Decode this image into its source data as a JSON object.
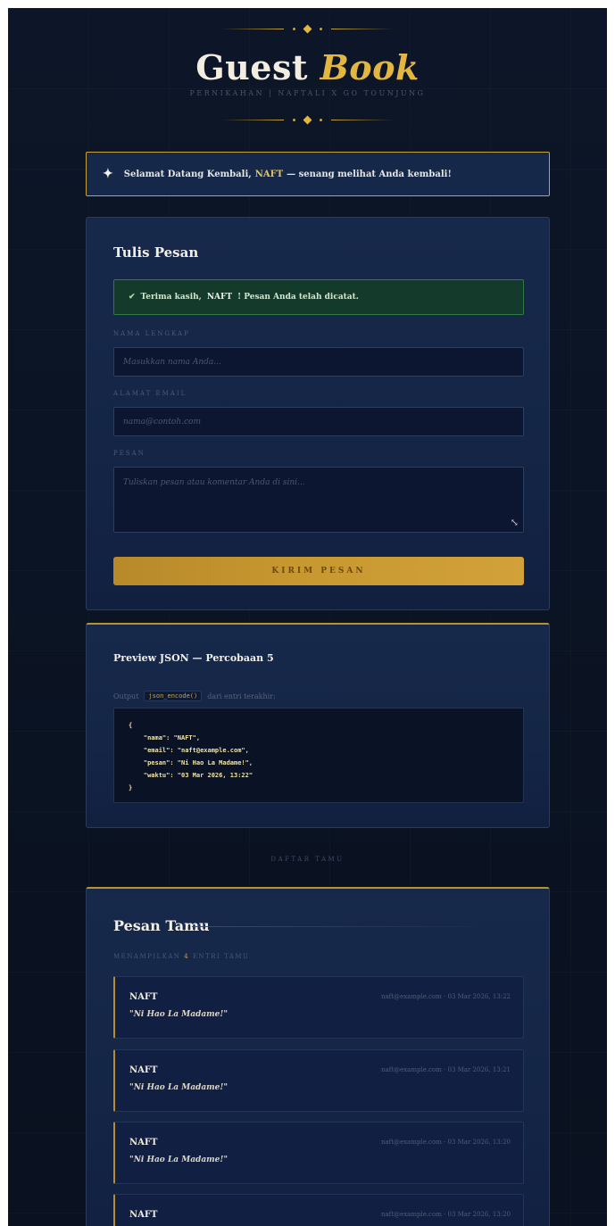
{
  "header": {
    "title_main": "Guest",
    "title_accent": "Book",
    "subtitle": "PERNIKAHAN | NAFTALI X GO TOUNJUNG"
  },
  "welcome": {
    "prefix": "Selamat Datang Kembali,",
    "name": "NAFT",
    "suffix": "— senang melihat Anda kembali!"
  },
  "form": {
    "title": "Tulis Pesan",
    "alert_prefix": "Terima kasih,",
    "alert_name": "NAFT",
    "alert_suffix": "! Pesan Anda telah dicatat.",
    "name_label": "NAMA LENGKAP",
    "name_placeholder": "Masukkan nama Anda...",
    "email_label": "ALAMAT EMAIL",
    "email_placeholder": "nama@contoh.com",
    "message_label": "PESAN",
    "message_placeholder": "Tuliskan pesan atau komentar Anda di sini...",
    "submit_label": "KIRIM PESAN"
  },
  "preview": {
    "title": "Preview JSON — Percobaan 5",
    "output_prefix": "Output",
    "output_code": "json_encode()",
    "output_suffix": "dari entri terakhir:",
    "code": "{\n    \"nama\": \"NAFT\",\n    \"email\": \"naft@example.com\",\n    \"pesan\": \"Ni Hao La Madame!\",\n    \"waktu\": \"03 Mar 2026, 13:22\"\n}"
  },
  "divider": "DAFTAR TAMU",
  "guestbook": {
    "title": "Pesan Tamu",
    "subtitle_prefix": "MENAMPILKAN",
    "subtitle_count": "4",
    "subtitle_suffix": "ENTRI TAMU",
    "entries": [
      {
        "name": "NAFT",
        "meta": "naft@example.com · 03 Mar 2026, 13:22",
        "message": "\"Ni Hao La Madame!\""
      },
      {
        "name": "NAFT",
        "meta": "naft@example.com · 03 Mar 2026, 13:21",
        "message": "\"Ni Hao La Madame!\""
      },
      {
        "name": "NAFT",
        "meta": "naft@example.com · 03 Mar 2026, 13:20",
        "message": "\"Ni Hao La Madame!\""
      },
      {
        "name": "NAFT",
        "meta": "naft@example.com · 03 Mar 2026, 13:20",
        "message": ""
      }
    ]
  },
  "colors": {
    "background": "#0b1424",
    "card": "#16284a",
    "gold": "#c9a23a",
    "success": "#2f7a45"
  }
}
